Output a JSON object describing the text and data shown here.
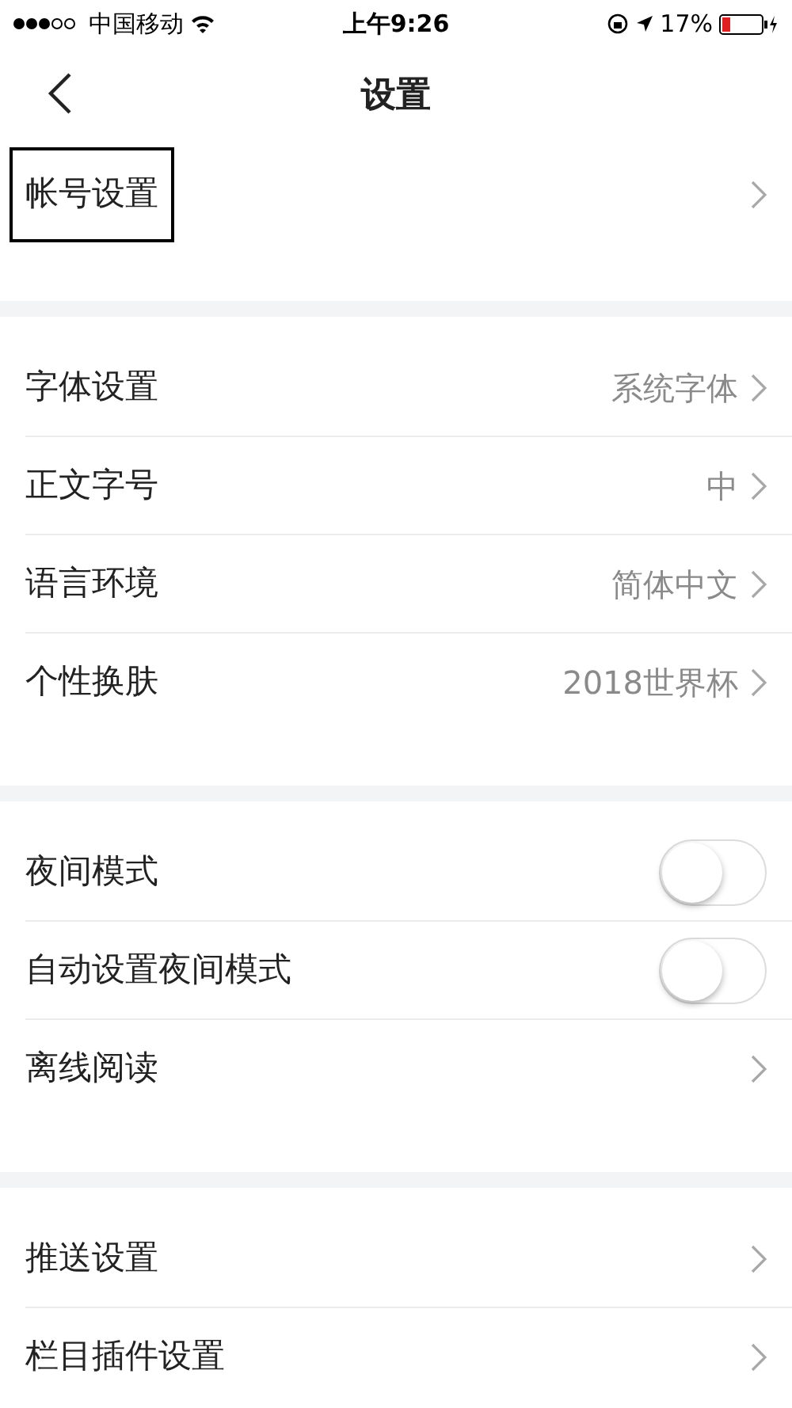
{
  "status_bar": {
    "carrier": "中国移动",
    "time": "上午9:26",
    "battery": "17%"
  },
  "nav": {
    "title": "设置"
  },
  "sections": [
    {
      "items": [
        {
          "kind": "link",
          "label": "帐号设置",
          "outlined": true
        }
      ]
    },
    {
      "items": [
        {
          "kind": "link",
          "label": "字体设置",
          "value": "系统字体",
          "outlined": false
        },
        {
          "kind": "link",
          "label": "正文字号",
          "value": "中",
          "outlined": false
        },
        {
          "kind": "link",
          "label": "语言环境",
          "value": "简体中文",
          "outlined": false
        },
        {
          "kind": "link",
          "label": "个性换肤",
          "value": "2018世界杯",
          "outlined": false
        }
      ]
    },
    {
      "items": [
        {
          "kind": "toggle",
          "label": "夜间模式",
          "on": false,
          "outlined": false
        },
        {
          "kind": "toggle",
          "label": "自动设置夜间模式",
          "on": false,
          "outlined": false
        },
        {
          "kind": "link",
          "label": "离线阅读",
          "outlined": false
        }
      ]
    },
    {
      "items": [
        {
          "kind": "link",
          "label": "推送设置",
          "outlined": false
        },
        {
          "kind": "link",
          "label": "栏目插件设置",
          "outlined": false
        }
      ]
    }
  ]
}
